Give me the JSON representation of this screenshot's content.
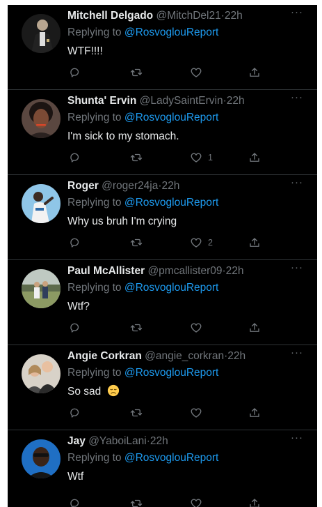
{
  "tweets": [
    {
      "name": "Mitchell Delgado",
      "handle": "@MitchDel21",
      "dot": "·",
      "time": "22h",
      "reply_prefix": "Replying to",
      "reply_target": "@RosvoglouReport",
      "text": "WTF!!!!",
      "likes": ""
    },
    {
      "name": "Shunta' Ervin",
      "handle": "@LadySaintErvin",
      "dot": "·",
      "time": "22h",
      "reply_prefix": "Replying to",
      "reply_target": "@RosvoglouReport",
      "text": "I'm sick to my stomach.",
      "likes": "1"
    },
    {
      "name": "Roger",
      "handle": "@roger24ja",
      "dot": "·",
      "time": "22h",
      "reply_prefix": "Replying to",
      "reply_target": "@RosvoglouReport",
      "text": "Why us bruh I'm crying",
      "likes": "2"
    },
    {
      "name": "Paul McAllister",
      "handle": "@pmcallister09",
      "dot": "·",
      "time": "22h",
      "reply_prefix": "Replying to",
      "reply_target": "@RosvoglouReport",
      "text": "Wtf?",
      "likes": ""
    },
    {
      "name": "Angie Corkran",
      "handle": "@angie_corkran",
      "dot": "·",
      "time": "22h",
      "reply_prefix": "Replying to",
      "reply_target": "@RosvoglouReport",
      "text": "So sad",
      "likes": ""
    },
    {
      "name": "Jay",
      "handle": "@YaboiLani",
      "dot": "·",
      "time": "22h",
      "reply_prefix": "Replying to",
      "reply_target": "@RosvoglouReport",
      "text": "Wtf",
      "likes": ""
    }
  ],
  "icons": {
    "more": "more-horizontal-icon",
    "reply": "reply-icon",
    "retweet": "retweet-icon",
    "like": "heart-icon",
    "share": "share-icon",
    "emoji": "disappointed-face-emoji"
  },
  "colors": {
    "background": "#000000",
    "name": "#e7e9ea",
    "secondary": "#71767b",
    "link": "#1d9bf0",
    "divider": "#2f3336"
  }
}
